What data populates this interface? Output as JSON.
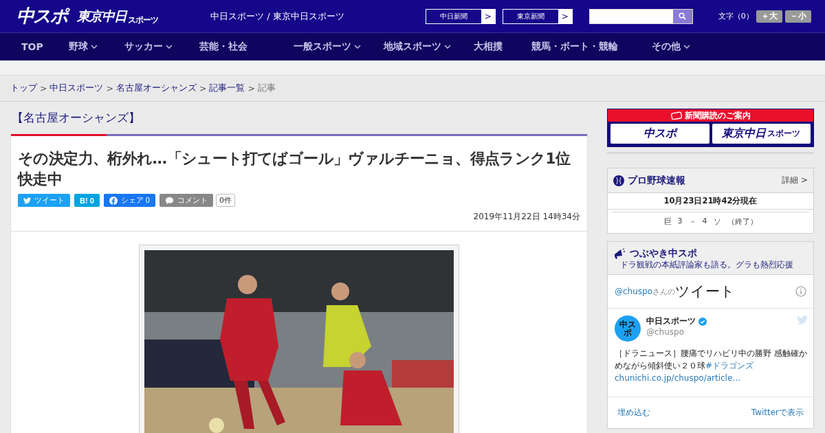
{
  "header": {
    "logo_main": "中スポ",
    "logo_sub": "東京中日",
    "logo_sub_small": "スポーツ",
    "tagline": "中日スポーツ / 東京中日スポーツ",
    "paper_links": [
      {
        "label": "中日新聞",
        "arrow": ">"
      },
      {
        "label": "東京新聞",
        "arrow": ">"
      }
    ],
    "font_size": {
      "label": "文字（0）",
      "buttons": [
        "＋大",
        "－小"
      ]
    }
  },
  "nav": [
    {
      "label": "TOP",
      "dropdown": false
    },
    {
      "label": "野球",
      "dropdown": true
    },
    {
      "label": "サッカー",
      "dropdown": true
    },
    {
      "label": "芸能・社会",
      "dropdown": false
    },
    {
      "label": "一般スポーツ",
      "dropdown": true
    },
    {
      "label": "地域スポーツ",
      "dropdown": true
    },
    {
      "label": "大相撲",
      "dropdown": false
    },
    {
      "label": "競馬・ボート・競輪",
      "dropdown": false
    },
    {
      "label": "その他",
      "dropdown": true
    }
  ],
  "breadcrumb": [
    {
      "label": "トップ",
      "link": true
    },
    {
      "label": "中日スポーツ",
      "link": true
    },
    {
      "label": "名古屋オーシャンズ",
      "link": true
    },
    {
      "label": "記事一覧",
      "link": true
    },
    {
      "label": "記事",
      "link": false
    }
  ],
  "article": {
    "category": "【名古屋オーシャンズ】",
    "title": "その決定力、桁外れ…「シュート打てばゴール」ヴァルチーニョ、得点ランク1位快走中",
    "share": [
      {
        "kind": "twitter",
        "label": "ツイート"
      },
      {
        "kind": "hatena",
        "label": "B!",
        "count": "0"
      },
      {
        "kind": "facebook",
        "label": "シェア",
        "count": "0"
      },
      {
        "kind": "comment",
        "label": "コメント",
        "count": "0件"
      }
    ],
    "date": "2019年11月22日 14時34分"
  },
  "sidebar": {
    "subscribe": {
      "title": "新聞購読のご案内",
      "logos": [
        "中スポ",
        "東京中日"
      ],
      "logo_small": "スポーツ"
    },
    "baseball": {
      "title": "プロ野球速報",
      "detail": "詳細 >",
      "time": "10月23日21時42分現在",
      "games": [
        {
          "home": "巨",
          "home_score": "3",
          "dash": "－",
          "away_score": "4",
          "away": "ソ",
          "status": "（終了）"
        }
      ]
    },
    "tweets": {
      "title": "つぶやき中スポ",
      "subtitle": "ドラ観戦の本紙評論家も語る。グラも熱烈応援",
      "handle": "@chuspo",
      "handle_suffix": "さんの",
      "heading": "ツイート",
      "avatar_text": "中スポ",
      "tweet": {
        "name": "中日スポーツ",
        "verified": true,
        "user": "@chuspo",
        "text": "［ドラニュース］腰痛でリハビリ中の勝野 感触確かめながら傾斜使い２０球",
        "hashtag": "#ドラゴンズ",
        "link": "chunichi.co.jp/chuspo/article…"
      },
      "footer": [
        "埋め込む",
        "Twitterで表示"
      ]
    }
  }
}
